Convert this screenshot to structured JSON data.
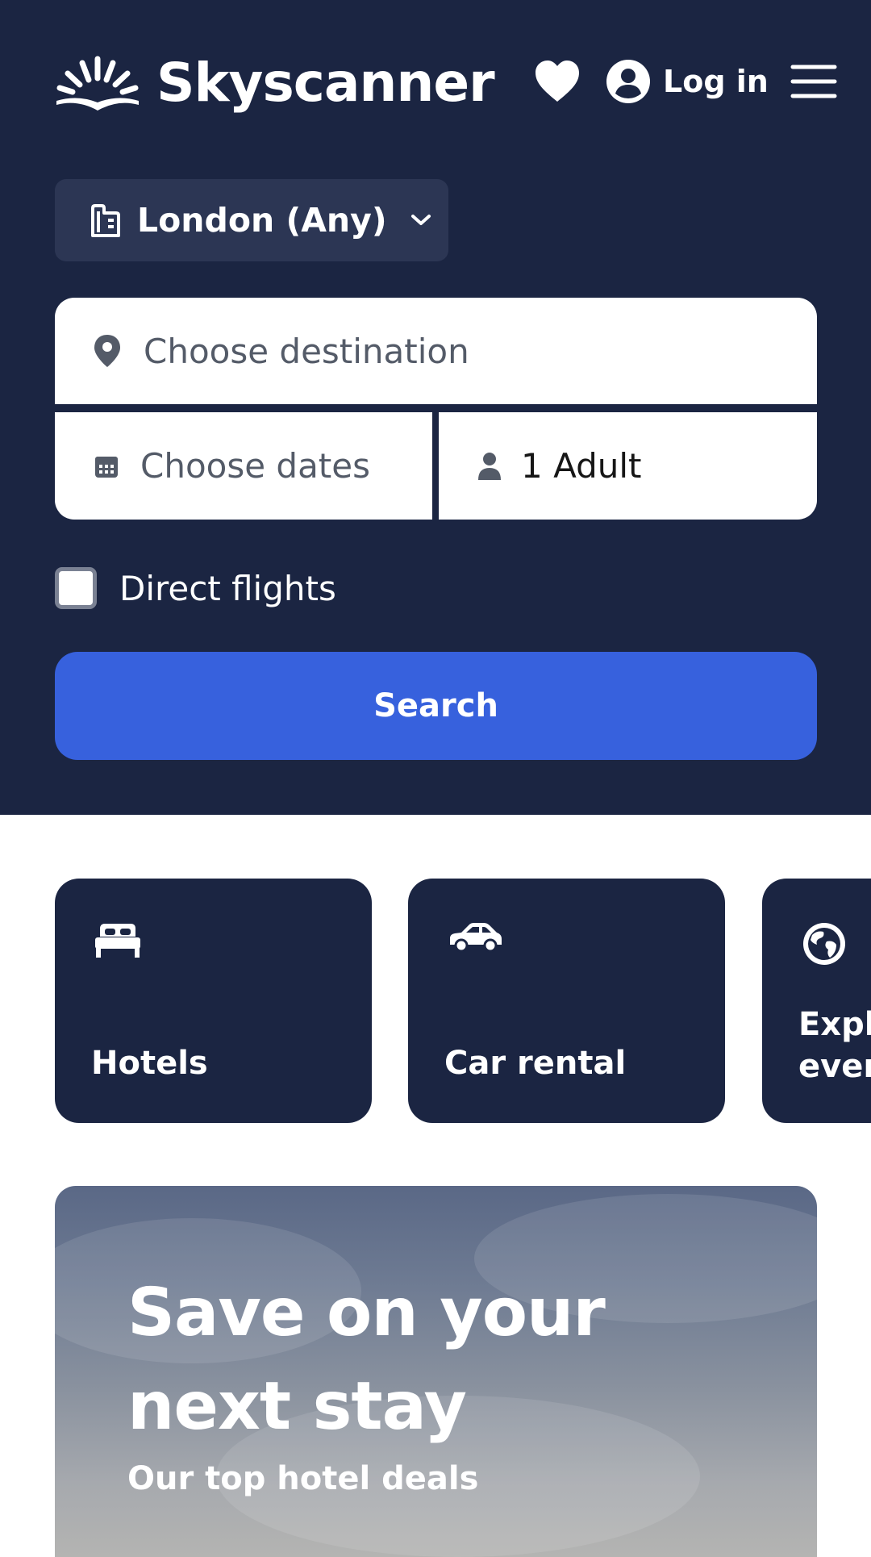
{
  "header": {
    "brand": "Skyscanner",
    "favourites_icon": "heart-icon",
    "account_icon": "user-circle-icon",
    "login_label": "Log in",
    "menu_icon": "hamburger-menu-icon"
  },
  "search": {
    "origin": "London (Any)",
    "origin_icon": "building-icon",
    "destination_placeholder": "Choose destination",
    "destination_icon": "location-pin-icon",
    "dates_placeholder": "Choose dates",
    "dates_icon": "calendar-icon",
    "travellers": "1 Adult",
    "travellers_icon": "person-icon",
    "direct_flights_label": "Direct flights",
    "direct_flights_checked": false,
    "search_label": "Search"
  },
  "cards": [
    {
      "label": "Hotels",
      "icon": "bed-icon"
    },
    {
      "label": "Car rental",
      "icon": "car-icon"
    },
    {
      "label_line1": "Expl",
      "label_line2": "ever",
      "icon": "globe-icon"
    }
  ],
  "promo": {
    "title": "Save on your next stay",
    "subtitle": "Our top hotel deals"
  },
  "colors": {
    "hero_background": "#1b2542",
    "origin_background": "#2c3654",
    "search_button": "#3761dd",
    "card_background": "#1b2542",
    "text_on_dark": "#ffffff",
    "placeholder_text": "#545b68"
  }
}
